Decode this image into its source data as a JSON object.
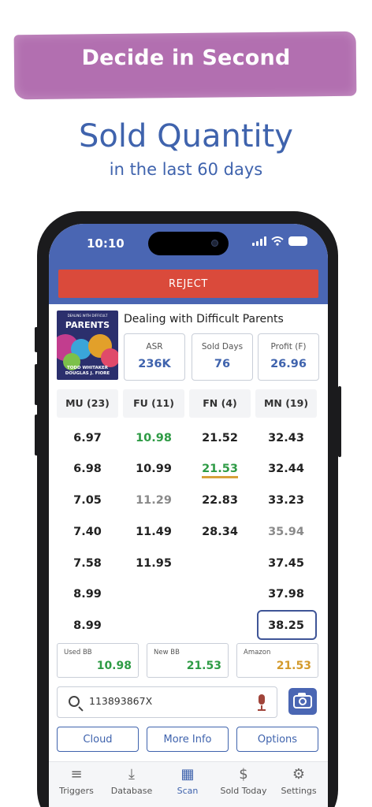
{
  "promo": {
    "banner": "Decide in Second",
    "headline": "Sold Quantity",
    "subheadline": "in the last 60 days"
  },
  "status_bar": {
    "time": "10:10"
  },
  "reject_button": "REJECT",
  "product": {
    "title": "Dealing with Difficult Parents",
    "cover": {
      "top_text": "DEALING WITH DIFFICULT",
      "title": "PARENTS",
      "authors": [
        "TODD WHITAKER",
        "DOUGLAS J. FIORE"
      ]
    },
    "stats": [
      {
        "label": "ASR",
        "value": "236K"
      },
      {
        "label": "Sold Days",
        "value": "76"
      },
      {
        "label": "Profit (F)",
        "value": "26.96"
      }
    ]
  },
  "offers": {
    "columns": [
      "MU (23)",
      "FU (11)",
      "FN (4)",
      "MN (19)"
    ],
    "rows": [
      [
        "6.97",
        "10.98",
        "21.52",
        "32.43"
      ],
      [
        "6.98",
        "10.99",
        "21.53",
        "32.44"
      ],
      [
        "7.05",
        "11.29",
        "22.83",
        "33.23"
      ],
      [
        "7.40",
        "11.49",
        "28.34",
        "35.94"
      ],
      [
        "7.58",
        "11.95",
        "",
        "37.45"
      ],
      [
        "8.99",
        "",
        "",
        "37.98"
      ],
      [
        "8.99",
        "",
        "",
        "38.25"
      ]
    ]
  },
  "buybox": [
    {
      "label": "Used BB",
      "value": "10.98",
      "color": "#2e9b45"
    },
    {
      "label": "New BB",
      "value": "21.53",
      "color": "#2e9b45"
    },
    {
      "label": "Amazon",
      "value": "21.53",
      "color": "#d39a2c"
    }
  ],
  "search": {
    "value": "113893867X"
  },
  "actions": [
    "Cloud",
    "More Info",
    "Options"
  ],
  "nav": [
    {
      "label": "Triggers",
      "icon": "triggers-icon"
    },
    {
      "label": "Database",
      "icon": "download-icon"
    },
    {
      "label": "Scan",
      "icon": "qr-scan-icon"
    },
    {
      "label": "Sold Today",
      "icon": "dollar-icon"
    },
    {
      "label": "Settings",
      "icon": "gear-icon"
    }
  ],
  "colors": {
    "brand_blue": "#4a66b3",
    "reject_red": "#da4a3b",
    "brush_purple": "#b26fb0",
    "price_green": "#2e9b45",
    "price_grey": "#8a8a8a",
    "amazon_gold": "#d39a2c"
  }
}
